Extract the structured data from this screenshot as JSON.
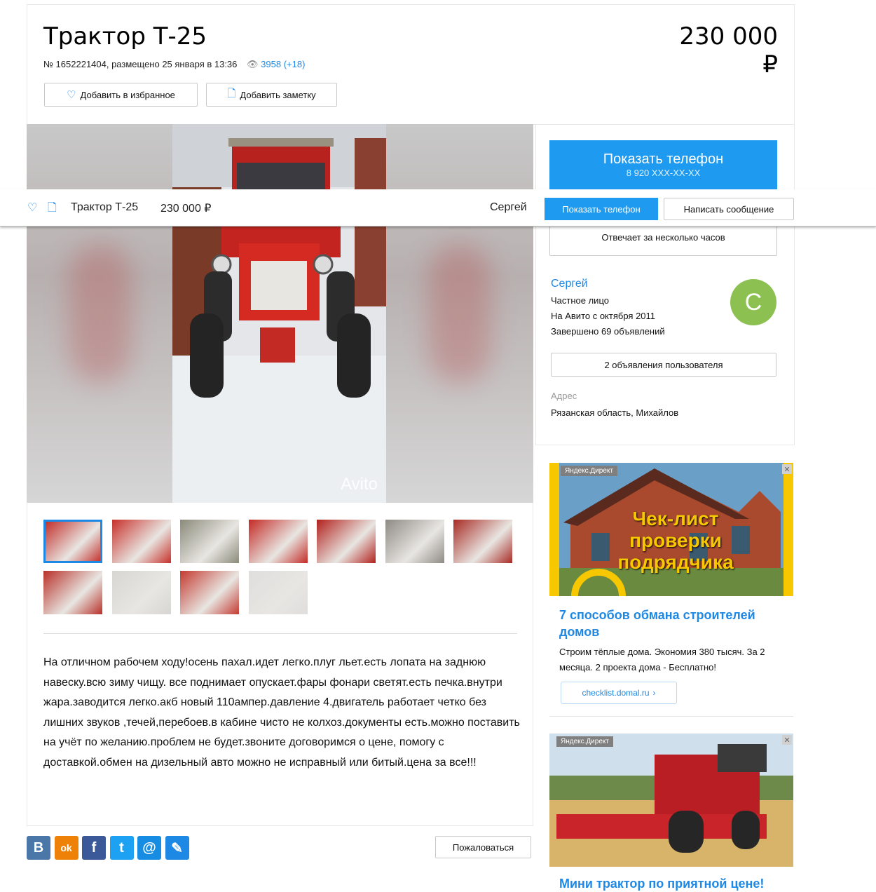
{
  "listing": {
    "title": "Трактор Т-25",
    "price": "230 000 ₽",
    "meta": "№ 1652221404, размещено 25 января в 13:36",
    "views": "3958 (+18)",
    "favorite_label": "Добавить в избранное",
    "note_label": "Добавить заметку"
  },
  "photo": {
    "watermark": "Avito"
  },
  "thumbnails": [
    {
      "color": "#c0221e"
    },
    {
      "color": "#c8302a"
    },
    {
      "color": "#8a8a7a"
    },
    {
      "color": "#c42a26"
    },
    {
      "color": "#b2201c"
    },
    {
      "color": "#8e8a86"
    },
    {
      "color": "#a82a24"
    },
    {
      "color": "#b83028"
    },
    {
      "color": "#d8d6d2"
    },
    {
      "color": "#c43a30"
    },
    {
      "color": "#e0dede"
    }
  ],
  "description": "На отличном рабочем ходу!осень пахал.идет легко.плуг льет.есть лопата на заднюю навеску.всю зиму чищу. все поднимает опускает.фары фонари светят.есть печка.внутри жара.заводится легко.акб новый 110ампер.давление 4.двигатель работает четко без лишних звуков ,течей,перебоев.в кабине чисто не колхоз.документы есть.можно поставить на учёт по желанию.проблем не будет.звоните договоримся о цене, помогу с доставкой.обмен на дизельный авто можно не исправный или битый.цена за все!!!",
  "share": {
    "complain_label": "Пожаловаться",
    "buttons": [
      {
        "name": "vk",
        "glyph": "В",
        "color": "#4a76a8"
      },
      {
        "name": "odnoklassniki",
        "glyph": "ok",
        "color": "#ee8208"
      },
      {
        "name": "facebook",
        "glyph": "f",
        "color": "#3b5998"
      },
      {
        "name": "twitter",
        "glyph": "t",
        "color": "#1da1f2"
      },
      {
        "name": "mail",
        "glyph": "@",
        "color": "#168de2"
      },
      {
        "name": "livejournal",
        "glyph": "✎",
        "color": "#1e88e5"
      }
    ]
  },
  "contact": {
    "show_phone_label": "Показать телефон",
    "phone_masked": "8 920 XXX-XX-XX",
    "answers_label": "Отвечает за несколько часов",
    "seller_name": "Сергей",
    "seller_type": "Частное лицо",
    "seller_since": "На Авито с октября 2011",
    "seller_completed": "Завершено 69 объявлений",
    "avatar_letter": "С",
    "user_ads_label": "2 объявления пользователя",
    "address_label": "Адрес",
    "address": "Рязанская область, Михайлов"
  },
  "sticky": {
    "title": "Трактор Т-25",
    "price": "230 000 ₽",
    "seller": "Сергей",
    "show_phone_label": "Показать телефон",
    "message_label": "Написать сообщение"
  },
  "ads": [
    {
      "badge": "Яндекс.Директ",
      "image_text": "Чек-лист проверки подрядчика",
      "title": "7 способов обмана строителей домов",
      "text": "Строим тёплые дома. Экономия 380 тысяч. За 2 месяца. 2 проекта дома - Бесплатно!",
      "link": "checklist.domal.ru"
    },
    {
      "badge": "Яндекс.Директ",
      "title": "Мини трактор по приятной цене!"
    }
  ]
}
